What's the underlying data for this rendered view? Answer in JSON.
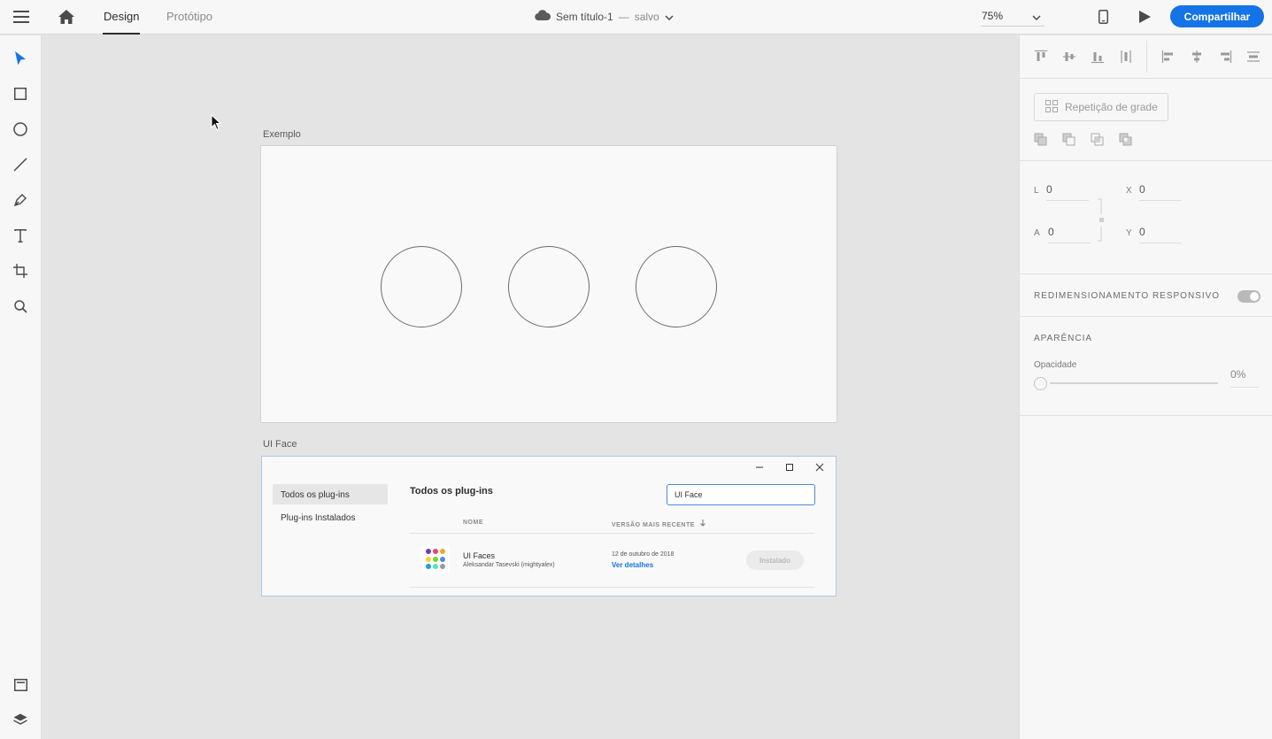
{
  "topbar": {
    "tabs": [
      {
        "label": "Design"
      },
      {
        "label": "Protótipo"
      }
    ],
    "document": {
      "name": "Sem título-1",
      "separator": "—",
      "status": "salvo"
    },
    "zoom": "75%",
    "share_label": "Compartilhar"
  },
  "canvas": {
    "artboard1_label": "Exemplo",
    "artboard2_label": "UI Face"
  },
  "plugins_window": {
    "sidebar": [
      "Todos os plug-ins",
      "Plug-ins Instalados"
    ],
    "title": "Todos os plug-ins",
    "search_value": "UI Face",
    "col_name": "NOME",
    "col_version": "VERSÃO MAIS RECENTE",
    "plugin": {
      "name": "UI Faces",
      "author": "Aleksandar Tasevski (mightyalex)",
      "date": "12 de outubro de 2018",
      "details_link": "Ver detalhes",
      "status_label": "Instalado"
    },
    "logo_colors": [
      "#6b3fa0",
      "#e0457b",
      "#f5a623",
      "#f7d02c",
      "#7ed321",
      "#4a90e2",
      "#1aa3c5",
      "#50e3c2",
      "#9b9b9b"
    ]
  },
  "properties": {
    "repeat_grid_label": "Repetição de grade",
    "fields": {
      "l_label": "L",
      "l_value": "0",
      "x_label": "X",
      "x_value": "0",
      "a_label": "A",
      "a_value": "0",
      "y_label": "Y",
      "y_value": "0"
    },
    "responsive_label": "REDIMENSIONAMENTO RESPONSIVO",
    "appearance_label": "APARÊNCIA",
    "opacity_label": "Opacidade",
    "opacity_value": "0%"
  },
  "colors": {
    "accent": "#1473e6",
    "select_tool": "#1473e6"
  }
}
